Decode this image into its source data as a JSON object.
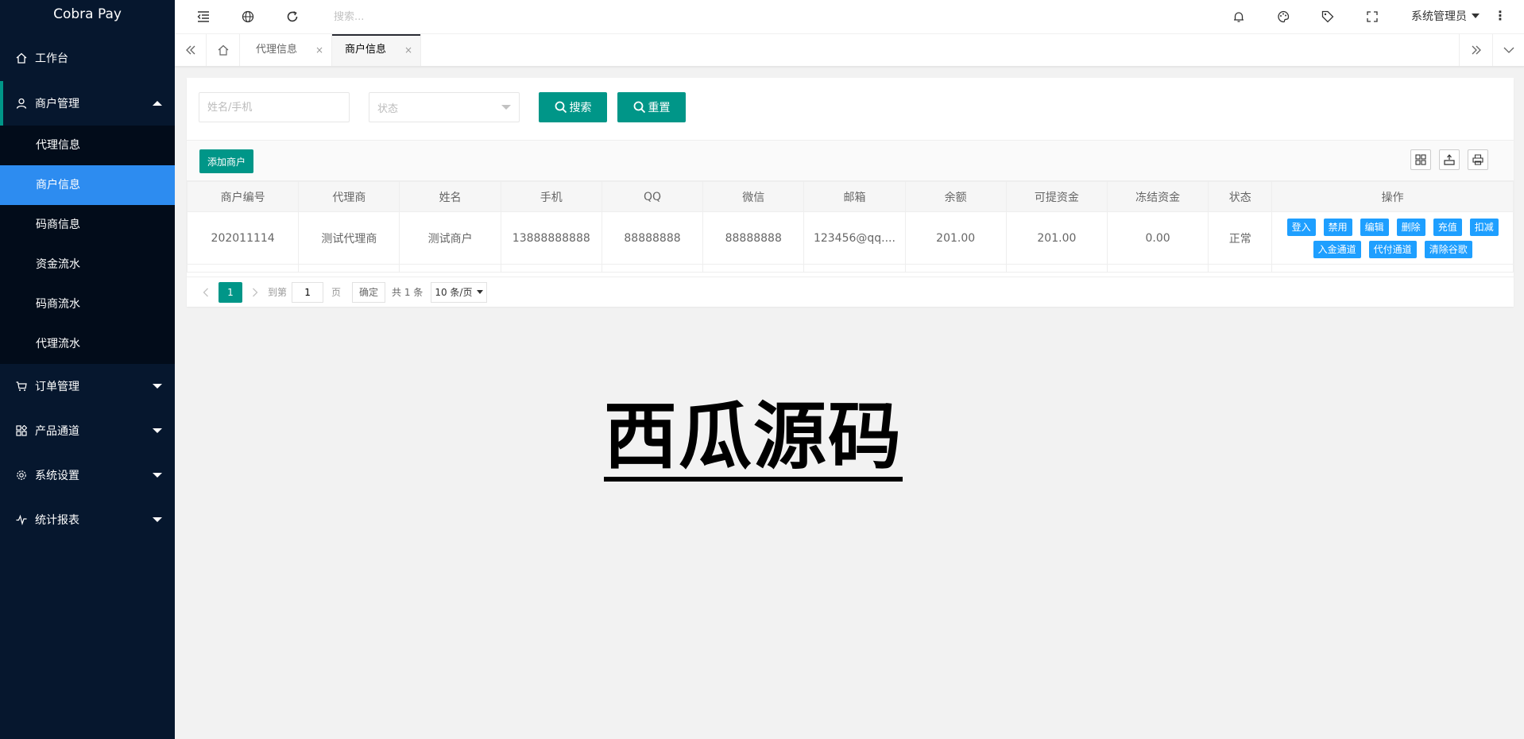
{
  "app": {
    "title": "Cobra Pay"
  },
  "sidebar": {
    "items": [
      {
        "label": "工作台",
        "icon": "home-icon"
      },
      {
        "label": "商户管理",
        "icon": "user-icon",
        "open": true,
        "children": [
          "代理信息",
          "商户信息",
          "码商信息",
          "资金流水",
          "码商流水",
          "代理流水"
        ],
        "active_child": "商户信息"
      },
      {
        "label": "订单管理",
        "icon": "cart-icon"
      },
      {
        "label": "产品通道",
        "icon": "apps-icon"
      },
      {
        "label": "系统设置",
        "icon": "gear-icon"
      },
      {
        "label": "统计报表",
        "icon": "chart-icon"
      }
    ]
  },
  "header": {
    "search_placeholder": "搜索...",
    "user_name": "系统管理员",
    "more_label": "⋮"
  },
  "tabs": [
    {
      "label": "代理信息",
      "close": "×"
    },
    {
      "label": "商户信息",
      "close": "×",
      "active": true
    }
  ],
  "filters": {
    "name_placeholder": "姓名/手机",
    "status_placeholder": "状态",
    "search_label": "搜索",
    "reset_label": "重置"
  },
  "toolbar": {
    "add_label": "添加商户"
  },
  "table": {
    "columns": [
      "商户编号",
      "代理商",
      "姓名",
      "手机",
      "QQ",
      "微信",
      "邮箱",
      "余额",
      "可提资金",
      "冻结资金",
      "状态",
      "操作"
    ],
    "rows": [
      {
        "cells": [
          "202011114",
          "测试代理商",
          "测试商户",
          "13888888888",
          "88888888",
          "88888888",
          "123456@qq....",
          "201.00",
          "201.00",
          "0.00",
          "正常"
        ],
        "actions": [
          "登入",
          "禁用",
          "编辑",
          "删除",
          "充值",
          "扣减",
          "入金通道",
          "代付通道",
          "清除谷歌"
        ]
      }
    ]
  },
  "pager": {
    "current": "1",
    "goto_label": "到第",
    "goto_value": "1",
    "page_label": "页",
    "confirm_label": "确定",
    "total_label": "共 1 条",
    "page_size": "10 条/页"
  },
  "watermark": "西瓜源码",
  "colors": {
    "sidebar_bg": "#06172e",
    "accent": "#009688",
    "active_blue": "#2d8cf0",
    "action_blue": "#1e9fff"
  }
}
